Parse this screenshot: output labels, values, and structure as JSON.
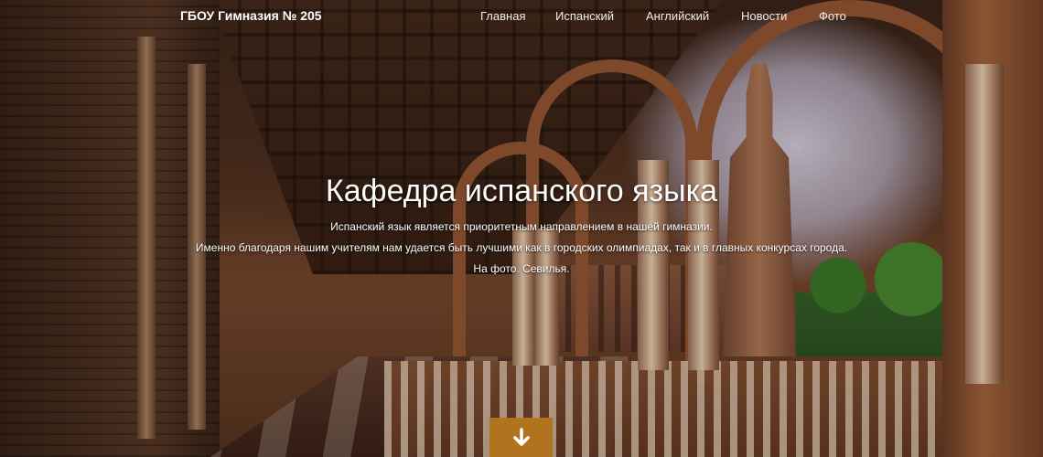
{
  "navbar": {
    "brand": "ГБОУ Гимназия № 205",
    "links": [
      "Главная",
      "Испанский",
      "Английский",
      "Новости",
      "Фото"
    ]
  },
  "hero": {
    "title": "Кафедра испанского языка",
    "lines": [
      "Испанский язык является приоритетным направлением в нашей гимназии.",
      "Именно благодаря нашим учителям нам удается быть лучшими как в городских олимпиадах, так и в главных конкурсах города.",
      "На фото. Севилья."
    ],
    "scroll_icon": "arrow-down-icon",
    "accent_color": "#b0741f"
  }
}
